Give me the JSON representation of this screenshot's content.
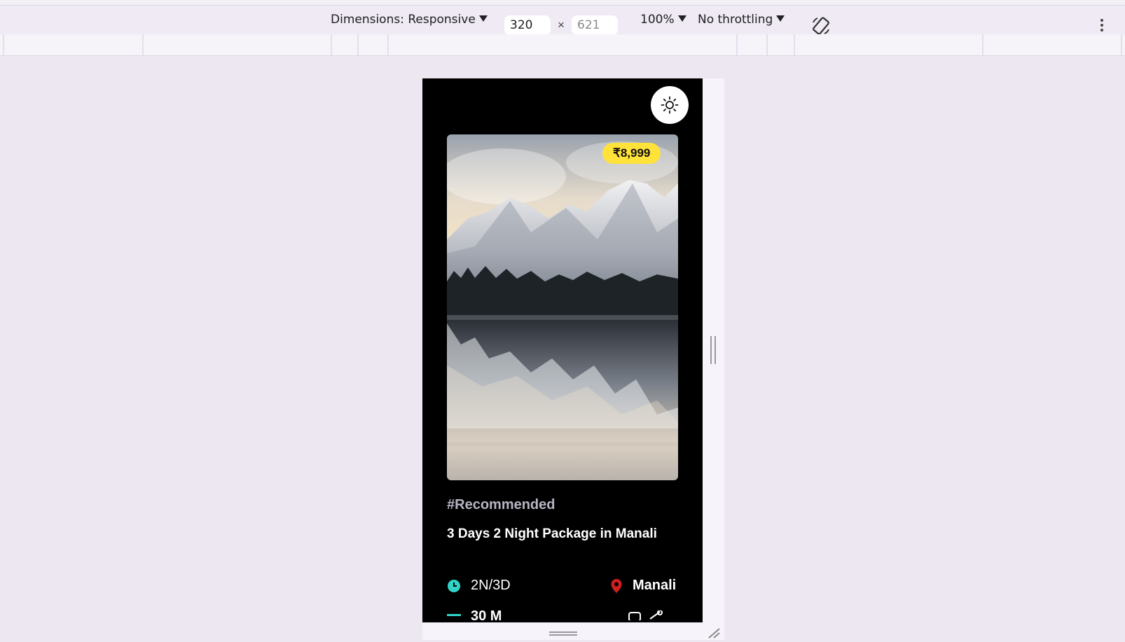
{
  "toolbar": {
    "dimensions_label": "Dimensions: Responsive",
    "width_value": "320",
    "height_placeholder": "621",
    "times": "×",
    "zoom": "100%",
    "throttling": "No throttling"
  },
  "card": {
    "price": "₹8,999",
    "tag": "#Recommended",
    "title": "3 Days 2 Night Package in Manali",
    "duration": "2N/3D",
    "location": "Manali",
    "next_row_partial": "30 M"
  },
  "icons": {
    "theme": "sun-icon",
    "duration": "clock-icon",
    "location": "map-pin-icon",
    "rotate": "rotate-device-icon",
    "more": "kebab-menu-icon"
  },
  "colors": {
    "badge": "#ffe23a",
    "clock": "#2fd4c6",
    "pin": "#d11f1f",
    "device_bg": "#000000"
  }
}
